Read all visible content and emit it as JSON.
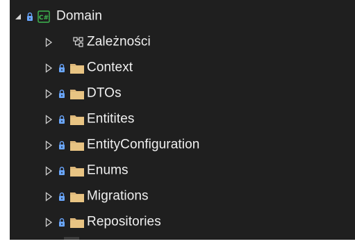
{
  "project": {
    "name": "Domain",
    "icon": "csharp-project-icon",
    "expanded": true
  },
  "dependencies": {
    "label": "Zależności",
    "icon": "dependencies-icon"
  },
  "folders": [
    {
      "name": "Context",
      "icon": "folder-icon"
    },
    {
      "name": "DTOs",
      "icon": "folder-icon"
    },
    {
      "name": "Entitites",
      "icon": "folder-icon"
    },
    {
      "name": "EntityConfiguration",
      "icon": "folder-icon"
    },
    {
      "name": "Enums",
      "icon": "folder-icon"
    },
    {
      "name": "Migrations",
      "icon": "folder-icon"
    },
    {
      "name": "Repositories",
      "icon": "folder-icon"
    }
  ],
  "colors": {
    "panel_bg": "#1f1f1f",
    "text": "#f0f0f0",
    "lock": "#6aa7ff",
    "folder": "#dcb67a",
    "csharp_badge": "#3fb950",
    "expander": "#cfcfcf"
  }
}
